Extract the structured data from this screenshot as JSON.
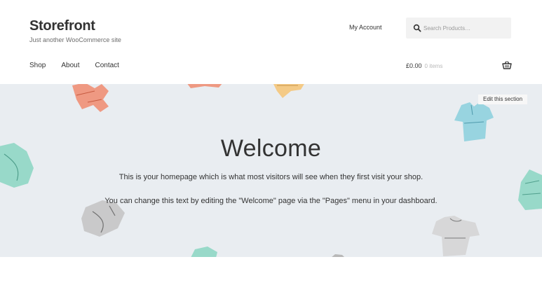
{
  "site": {
    "title": "Storefront",
    "description": "Just another WooCommerce site"
  },
  "header": {
    "account_link": "My Account",
    "search": {
      "placeholder": "Search Products…",
      "value": ""
    }
  },
  "nav": {
    "items": [
      {
        "label": "Shop"
      },
      {
        "label": "About"
      },
      {
        "label": "Contact"
      }
    ]
  },
  "cart": {
    "total": "£0.00",
    "count": "0 items"
  },
  "hero": {
    "edit_label": "Edit this section",
    "title": "Welcome",
    "paragraph1": "This is your homepage which is what most visitors will see when they first visit your shop.",
    "paragraph2": "You can change this text by editing the \"Welcome\" page via the \"Pages\" menu in your dashboard."
  },
  "colors": {
    "hero_background": "#e9edf1",
    "text": "#333333",
    "search_background": "#f2f2f2",
    "muted": "#b8b8b8"
  },
  "icons": [
    "search-icon",
    "basket-icon"
  ]
}
